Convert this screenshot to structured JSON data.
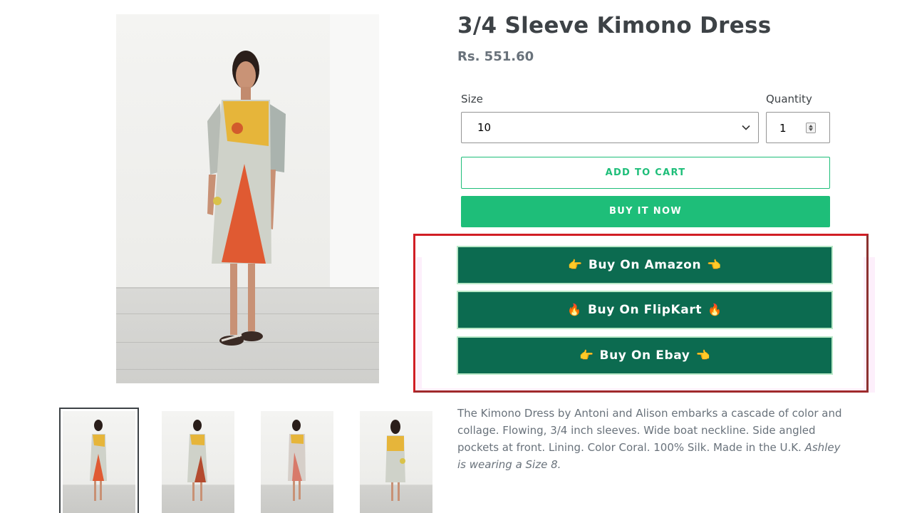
{
  "product": {
    "title": "3/4 Sleeve Kimono Dress",
    "price": "Rs. 551.60",
    "size_label": "Size",
    "size_value": "10",
    "quantity_label": "Quantity",
    "quantity_value": "1",
    "add_to_cart_label": "ADD TO CART",
    "buy_now_label": "BUY IT NOW",
    "description": "The Kimono Dress by Antoni and Alison embarks a cascade of color and collage. Flowing, 3/4 inch sleeves. Wide boat neckline. Side angled pockets at front. Lining. Color Coral. 100% Silk. Made in the U.K.",
    "description_note": "Ashley is wearing a Size 8."
  },
  "marketplaces": [
    {
      "label": "Buy On Amazon",
      "left_icon": "👉",
      "right_icon": "👈"
    },
    {
      "label": "Buy On FlipKart",
      "left_icon": "🔥",
      "right_icon": "🔥"
    },
    {
      "label": "Buy On Ebay",
      "left_icon": "👉",
      "right_icon": "👈"
    }
  ],
  "thumbnails": [
    {
      "name": "front-view",
      "active": true
    },
    {
      "name": "front-view-2",
      "active": false
    },
    {
      "name": "side-view",
      "active": false
    },
    {
      "name": "back-view",
      "active": false
    }
  ],
  "colors": {
    "accent": "#1ebe79",
    "marketplace_button": "#0c6b50",
    "highlight_border": "#d11e25",
    "text": "#3d4246",
    "muted_text": "#69727b"
  }
}
